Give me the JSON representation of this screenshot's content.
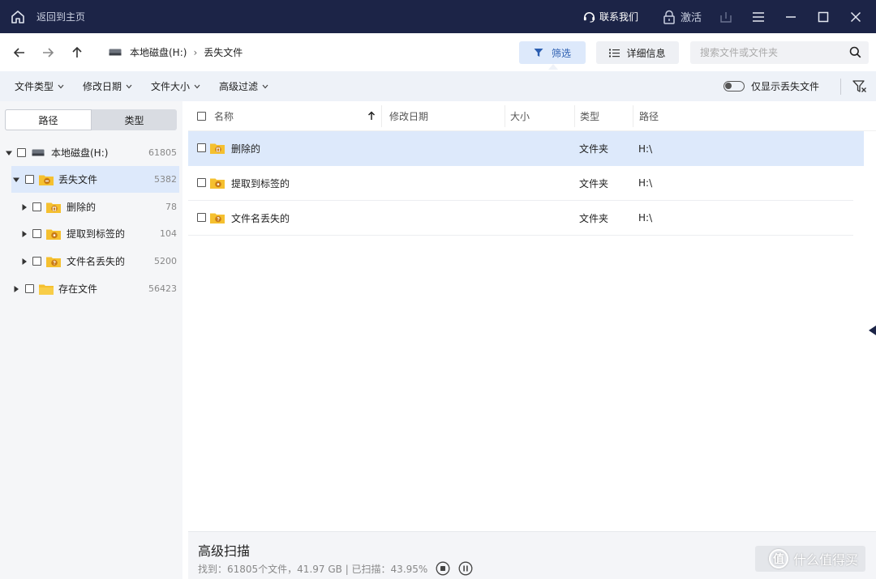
{
  "colors": {
    "titlebar_bg": "#1c2447",
    "accent": "#2a5db0",
    "selected_bg": "#dde9fb",
    "folder_yellow": "#f5c02f",
    "folder_badge": "#c97a16"
  },
  "titlebar": {
    "home_icon": "home-icon",
    "home_label": "返回到主页",
    "contact_label": "联系我们",
    "activate_label": "激活"
  },
  "navbar": {
    "breadcrumb": {
      "drive": "本地磁盘(H:)",
      "separator": "›",
      "current": "丢失文件"
    },
    "filter_label": "筛选",
    "details_label": "详细信息",
    "search_placeholder": "搜索文件或文件夹"
  },
  "filterbar": {
    "dropdowns": [
      "文件类型",
      "修改日期",
      "文件大小",
      "高级过滤"
    ],
    "toggle_label": "仅显示丢失文件",
    "toggle_on": false
  },
  "sidebar": {
    "tabs": [
      "路径",
      "类型"
    ],
    "active_tab": 0,
    "tree": [
      {
        "label": "本地磁盘(H:)",
        "count": "61805",
        "level": 0,
        "expanded": true,
        "icon": "drive-icon"
      },
      {
        "label": "丢失文件",
        "count": "5382",
        "level": 1,
        "expanded": true,
        "icon": "lost-folder-icon",
        "selected": true
      },
      {
        "label": "删除的",
        "count": "78",
        "level": 2,
        "expanded": false,
        "icon": "deleted-folder-icon"
      },
      {
        "label": "提取到标签的",
        "count": "104",
        "level": 2,
        "expanded": false,
        "icon": "tagged-folder-icon"
      },
      {
        "label": "文件名丢失的",
        "count": "5200",
        "level": 2,
        "expanded": false,
        "icon": "unnamed-folder-icon"
      },
      {
        "label": "存在文件",
        "count": "56423",
        "level": 0,
        "expanded": false,
        "icon": "folder-icon"
      }
    ]
  },
  "list": {
    "columns": {
      "name": "名称",
      "modified": "修改日期",
      "size": "大小",
      "type": "类型",
      "path": "路径"
    },
    "rows": [
      {
        "name": "删除的",
        "modified": "",
        "size": "",
        "type": "文件夹",
        "path": "H:\\",
        "icon": "deleted-folder-icon",
        "selected": true
      },
      {
        "name": "提取到标签的",
        "modified": "",
        "size": "",
        "type": "文件夹",
        "path": "H:\\",
        "icon": "tagged-folder-icon"
      },
      {
        "name": "文件名丢失的",
        "modified": "",
        "size": "",
        "type": "文件夹",
        "path": "H:\\",
        "icon": "unnamed-folder-icon"
      }
    ]
  },
  "scan": {
    "title": "高级扫描",
    "stats": "找到：61805个文件，41.97 GB | 已扫描：43.95%",
    "progress_percent": 43.95
  },
  "watermark": {
    "badge": "值",
    "text": "什么值得买"
  }
}
